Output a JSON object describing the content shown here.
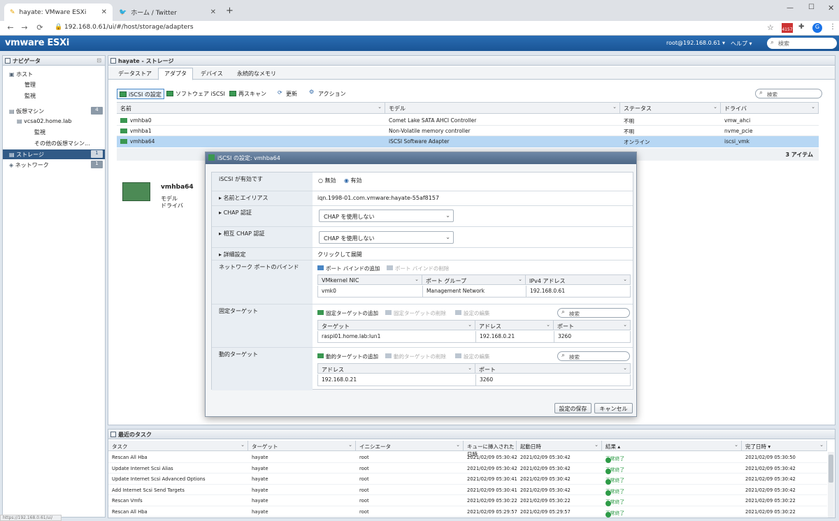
{
  "browser": {
    "tabs": [
      {
        "label": "hayate: VMware ESXi"
      },
      {
        "label": "ホーム / Twitter"
      }
    ],
    "url": "192.168.0.61/ui/#/host/storage/adapters",
    "ext_badge": "4157",
    "avatar": "G"
  },
  "vmware": {
    "logo": "vmware ESXi",
    "user": "root@192.168.0.61 ▾",
    "help": "ヘルプ ▾",
    "search_placeholder": "検索"
  },
  "navigator": {
    "title": "ナビゲータ",
    "items": [
      {
        "label": "ホスト"
      },
      {
        "label": "管理"
      },
      {
        "label": "監視"
      },
      {
        "label": "仮想マシン",
        "badge": "4"
      },
      {
        "label": "vcsa02.home.lab"
      },
      {
        "label": "監視"
      },
      {
        "label": "その他の仮想マシン..."
      },
      {
        "label": "ストレージ",
        "badge": "1"
      },
      {
        "label": "ネットワーク",
        "badge": "1"
      }
    ]
  },
  "main": {
    "title": "hayate - ストレージ",
    "tabs": [
      "データストア",
      "アダプタ",
      "デバイス",
      "永続的なメモリ"
    ],
    "toolbar": {
      "iscsi": "iSCSI の設定",
      "sw_iscsi": "ソフトウェア iSCSI",
      "rescan": "再スキャン",
      "refresh": "更新",
      "actions": "アクション",
      "search_placeholder": "検索"
    },
    "columns": [
      "名前",
      "モデル",
      "ステータス",
      "ドライバ"
    ],
    "rows": [
      {
        "name": "vmhba0",
        "model": "Comet Lake SATA AHCI Controller",
        "status": "不明",
        "driver": "vmw_ahci"
      },
      {
        "name": "vmhba1",
        "model": "Non-Volatile memory controller",
        "status": "不明",
        "driver": "nvme_pcie"
      },
      {
        "name": "vmhba64",
        "model": "iSCSI Software Adapter",
        "status": "オンライン",
        "driver": "iscsi_vmk"
      }
    ],
    "count": "3 アイテム",
    "detail": {
      "name": "vmhba64",
      "labels": [
        "モデル",
        "ドライバ"
      ]
    }
  },
  "dialog": {
    "title": "iSCSI の設定: vmhba64",
    "enabled_label": "iSCSI が有効です",
    "disabled_opt": "無効",
    "enabled_opt": "有効",
    "name_alias_label": "名前とエイリアス",
    "iqn": "iqn.1998-01.com.vmware:hayate-55af8157",
    "chap_label": "CHAP 認証",
    "chap_value": "CHAP を使用しない",
    "mutual_chap_label": "相互 CHAP 認証",
    "mutual_chap_value": "CHAP を使用しない",
    "advanced_label": "詳細設定",
    "advanced_value": "クリックして展開",
    "port_binding_label": "ネットワーク ポートのバインド",
    "add_port": "ポート バインドの追加",
    "remove_port": "ポート バインドの削除",
    "port_columns": [
      "VMkernel NIC",
      "ポート グループ",
      "IPv4 アドレス"
    ],
    "port_row": [
      "vmk0",
      "Management Network",
      "192.168.0.61"
    ],
    "static_label": "固定ターゲット",
    "add_static": "固定ターゲットの追加",
    "remove_static": "固定ターゲットの削除",
    "edit_settings": "設定の編集",
    "search_placeholder": "検索",
    "static_columns": [
      "ターゲット",
      "アドレス",
      "ポート"
    ],
    "static_row": [
      "raspi01.home.lab:lun1",
      "192.168.0.21",
      "3260"
    ],
    "dynamic_label": "動的ターゲット",
    "add_dynamic": "動的ターゲットの追加",
    "remove_dynamic": "動的ターゲットの削除",
    "dynamic_columns": [
      "アドレス",
      "ポート"
    ],
    "dynamic_row": [
      "192.168.0.21",
      "3260"
    ],
    "save": "設定の保存",
    "cancel": "キャンセル"
  },
  "tasks": {
    "title": "最近のタスク",
    "columns": [
      "タスク",
      "ターゲット",
      "イニシエータ",
      "キューに挿入された日時",
      "起動日時",
      "結果 ▴",
      "完了日時 ▾"
    ],
    "rows": [
      [
        "Rescan All Hba",
        "hayate",
        "root",
        "2021/02/09 05:30:42",
        "2021/02/09 05:30:42",
        "正常終了",
        "2021/02/09 05:30:50"
      ],
      [
        "Update Internet Scsi Alias",
        "hayate",
        "root",
        "2021/02/09 05:30:42",
        "2021/02/09 05:30:42",
        "正常終了",
        "2021/02/09 05:30:42"
      ],
      [
        "Update Internet Scsi Advanced Options",
        "hayate",
        "root",
        "2021/02/09 05:30:41",
        "2021/02/09 05:30:42",
        "正常終了",
        "2021/02/09 05:30:42"
      ],
      [
        "Add Internet Scsi Send Targets",
        "hayate",
        "root",
        "2021/02/09 05:30:41",
        "2021/02/09 05:30:42",
        "正常終了",
        "2021/02/09 05:30:42"
      ],
      [
        "Rescan Vmfs",
        "hayate",
        "root",
        "2021/02/09 05:30:22",
        "2021/02/09 05:30:22",
        "正常終了",
        "2021/02/09 05:30:22"
      ],
      [
        "Rescan All Hba",
        "hayate",
        "root",
        "2021/02/09 05:29:57",
        "2021/02/09 05:29:57",
        "正常終了",
        "2021/02/09 05:30:22"
      ]
    ]
  },
  "status_url": "https://192.168.0.61/ui/"
}
